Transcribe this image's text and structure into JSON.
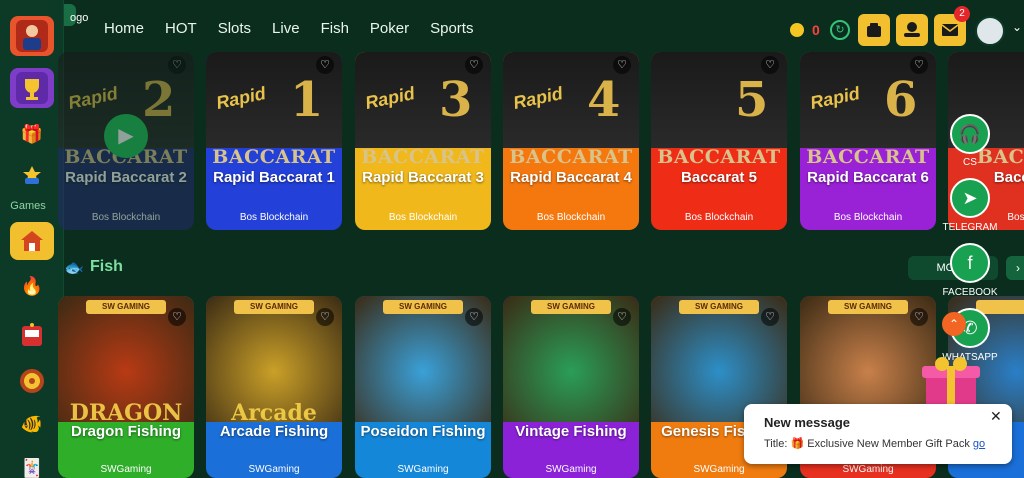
{
  "header": {
    "logo_text": "ogo",
    "nav": [
      "Home",
      "HOT",
      "Slots",
      "Live",
      "Fish",
      "Poker",
      "Sports"
    ],
    "balance": "0",
    "notification_count": "2"
  },
  "sidebar": {
    "games_label": "Games"
  },
  "baccarat_cards": [
    {
      "word": "BACCARAT",
      "title": "Rapid Baccarat 2",
      "provider": "Bos Blockchain",
      "number": "2",
      "rapid": "Rapid",
      "color": "#232b6b"
    },
    {
      "word": "BACCARAT",
      "title": "Rapid Baccarat 1",
      "provider": "Bos Blockchain",
      "number": "1",
      "rapid": "Rapid",
      "color": "#2340d8"
    },
    {
      "word": "BACCARAT",
      "title": "Rapid Baccarat 3",
      "provider": "Bos Blockchain",
      "number": "3",
      "rapid": "Rapid",
      "color": "#f0b81a"
    },
    {
      "word": "BACCARAT",
      "title": "Rapid Baccarat 4",
      "provider": "Bos Blockchain",
      "number": "4",
      "rapid": "Rapid",
      "color": "#f5780f"
    },
    {
      "word": "BACCARAT",
      "title": "Baccarat 5",
      "provider": "Bos Blockchain",
      "number": "5",
      "rapid": "",
      "color": "#ef2d17"
    },
    {
      "word": "BACCARAT",
      "title": "Rapid Baccarat 6",
      "provider": "Bos Blockchain",
      "number": "6",
      "rapid": "Rapid",
      "color": "#9a22d6"
    },
    {
      "word": "BACCA",
      "title": "Bacca",
      "provider": "Bos",
      "number": "",
      "rapid": "",
      "color": "#e03020"
    }
  ],
  "fish_section": {
    "title": "Fish",
    "more_label": "MORE"
  },
  "fish_cards": [
    {
      "brand": "SW GAMING",
      "art": "DRAGON",
      "title": "Dragon Fishing",
      "provider": "SWGaming",
      "color": "#2fae2a",
      "art_color": "#b83a14"
    },
    {
      "brand": "SW GAMING",
      "art": "Arcade",
      "title": "Arcade Fishing",
      "provider": "SWGaming",
      "color": "#1a6fd8",
      "art_color": "#caa028"
    },
    {
      "brand": "SW GAMING",
      "art": "",
      "title": "Poseidon Fishing",
      "provider": "SWGaming",
      "color": "#1587d8",
      "art_color": "#3aa0d8"
    },
    {
      "brand": "SW GAMING",
      "art": "",
      "title": "Vintage Fishing",
      "provider": "SWGaming",
      "color": "#8c22d8",
      "art_color": "#2a9e58"
    },
    {
      "brand": "SW GAMING",
      "art": "",
      "title": "Genesis Fishing",
      "provider": "SWGaming",
      "color": "#f07c10",
      "art_color": "#2d8fc8"
    },
    {
      "brand": "SW GAMING",
      "art": "",
      "title": "",
      "provider": "SWGaming",
      "color": "#e83020",
      "art_color": "#c8804a"
    },
    {
      "brand": "",
      "art": "",
      "title": "",
      "provider": "",
      "color": "#1a6fd8",
      "art_color": "#2a7fc8"
    }
  ],
  "social": [
    {
      "label": "CS",
      "icon": "headset-icon"
    },
    {
      "label": "TELEGRAM",
      "icon": "telegram-icon"
    },
    {
      "label": "FACEBOOK",
      "icon": "facebook-icon"
    },
    {
      "label": "WHATSAPP",
      "icon": "whatsapp-icon"
    }
  ],
  "message": {
    "title": "New message",
    "body_prefix": "Title: 🎁 Exclusive New Member Gift Pack",
    "link": "go"
  }
}
